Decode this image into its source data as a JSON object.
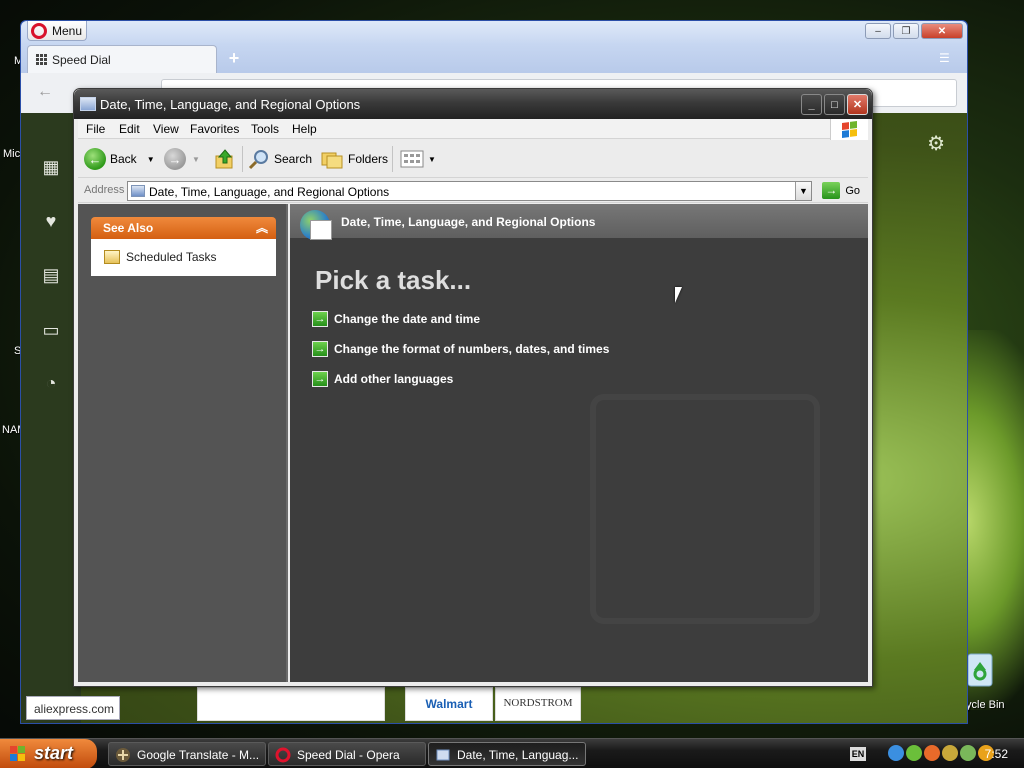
{
  "desktop": {
    "labels": [
      "Mic",
      "Mic",
      "S",
      "NAM"
    ],
    "recycle_bin_label": "ycle Bin"
  },
  "opera": {
    "menu_label": "Menu",
    "tab_label": "Speed Dial",
    "new_tab_symbol": "+",
    "status_url": "aliexpress.com",
    "speed_dial_tiles": [
      "Walmart",
      "NORDSTROM"
    ]
  },
  "xp_window": {
    "title": "Date, Time, Language, and Regional Options",
    "menu": [
      "File",
      "Edit",
      "View",
      "Favorites",
      "Tools",
      "Help"
    ],
    "toolbar": {
      "back_label": "Back",
      "search_label": "Search",
      "folders_label": "Folders"
    },
    "address": {
      "label": "Address",
      "value": "Date, Time, Language, and Regional Options",
      "go_label": "Go"
    },
    "see_also": {
      "header": "See Also",
      "items": [
        "Scheduled Tasks"
      ]
    },
    "banner_title": "Date, Time, Language, and Regional Options",
    "heading": "Pick a task...",
    "tasks": [
      "Change the date and time",
      "Change the format of numbers, dates, and times",
      "Add other languages"
    ]
  },
  "taskbar": {
    "start_label": "start",
    "tasks": [
      {
        "label": "Google Translate - M...",
        "active": false
      },
      {
        "label": "Speed Dial - Opera",
        "active": false
      },
      {
        "label": "Date, Time, Languag...",
        "active": true
      }
    ],
    "language": "EN",
    "clock": "7:52"
  },
  "colors": {
    "start_orange": "#d45f12",
    "task_green": "#27901a"
  }
}
